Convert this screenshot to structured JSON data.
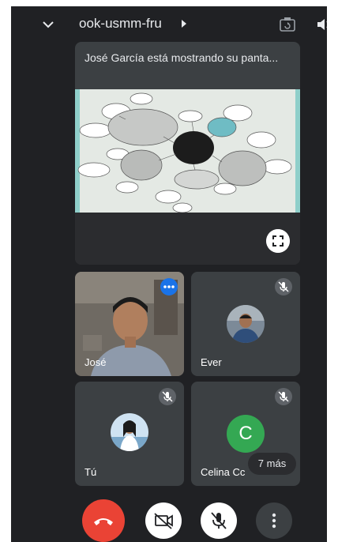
{
  "topbar": {
    "meeting_code": "ook-usmm-fru"
  },
  "presentation": {
    "title": "José García está mostrando su panta..."
  },
  "tiles": [
    {
      "name": "José"
    },
    {
      "name": "Ever"
    },
    {
      "name": "Tú"
    },
    {
      "name": "Celina Cc",
      "initial": "C"
    }
  ],
  "overflow": {
    "label": "7 más"
  },
  "colors": {
    "background": "#202124",
    "tile": "#3c4043",
    "end_call": "#ea4335",
    "avatar_celina": "#34a853"
  },
  "icons": [
    "chevron-down-icon",
    "arrow-right-icon",
    "switch-camera-icon",
    "speaker-icon",
    "fullscreen-icon",
    "mic-off-icon",
    "more-options-icon",
    "end-call-icon",
    "camera-off-icon",
    "more-vert-icon"
  ]
}
